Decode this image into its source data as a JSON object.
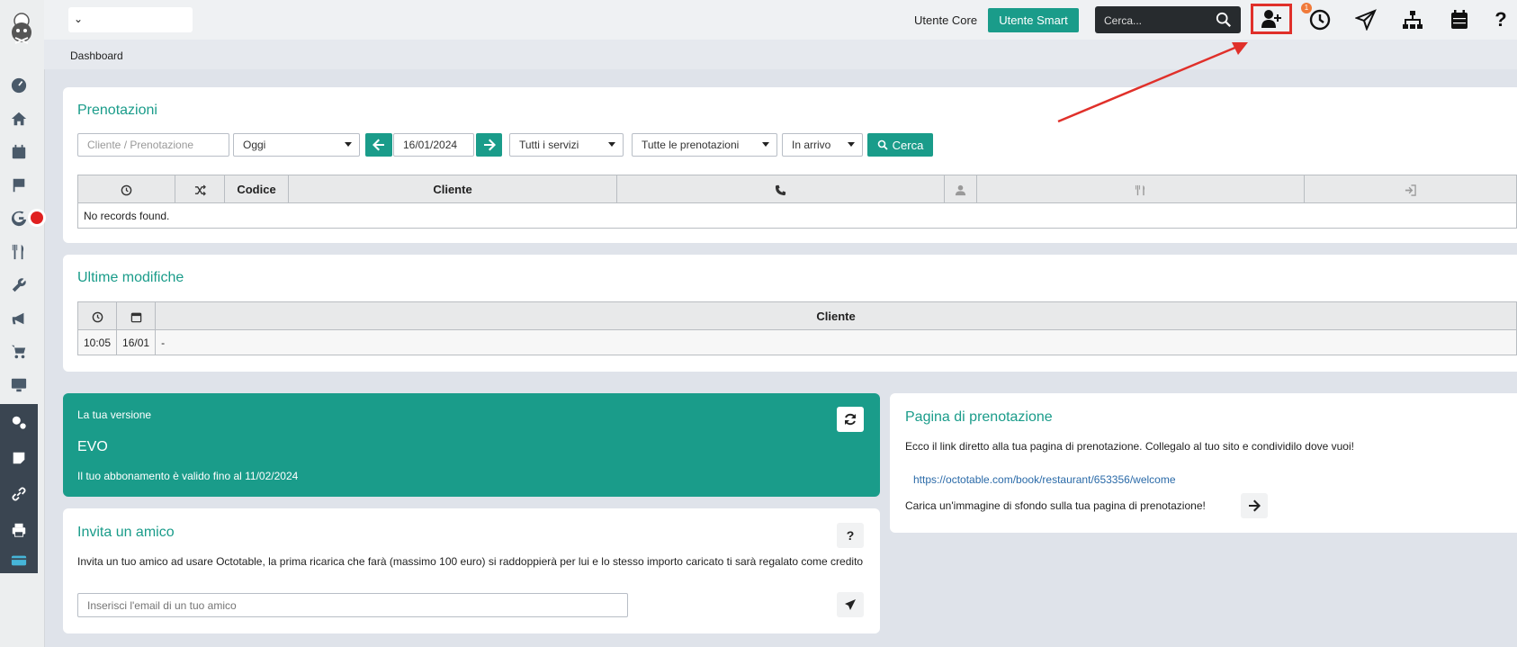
{
  "topbar": {
    "utente_core": "Utente Core",
    "utente_smart": "Utente Smart",
    "search_placeholder": "Cerca...",
    "notification_count": "1",
    "help": "?"
  },
  "breadcrumb": "Dashboard",
  "prenotazioni": {
    "title": "Prenotazioni",
    "search_placeholder": "Cliente / Prenotazione",
    "period": "Oggi",
    "date": "16/01/2024",
    "services": "Tutti i servizi",
    "bookings": "Tutte le prenotazioni",
    "status": "In arrivo",
    "search_button": "Cerca",
    "columns": [
      "",
      "",
      "Codice",
      "Cliente",
      "",
      "",
      "",
      ""
    ],
    "empty": "No records found."
  },
  "ultime": {
    "title": "Ultime modifiche",
    "column_cliente": "Cliente",
    "row": {
      "time": "10:05",
      "date": "16/01",
      "cliente": "-"
    }
  },
  "versione": {
    "label": "La tua versione",
    "name": "EVO",
    "validity": "Il tuo abbonamento è valido fino al 11/02/2024"
  },
  "invita": {
    "title": "Invita un amico",
    "help": "?",
    "text": "Invita un tuo amico ad usare Octotable, la prima ricarica che farà (massimo 100 euro) si raddoppierà per lui e lo stesso importo caricato ti sarà regalato come credito",
    "email_placeholder": "Inserisci l'email di un tuo amico"
  },
  "pagina": {
    "title": "Pagina di prenotazione",
    "text": "Ecco il link diretto alla tua pagina di prenotazione. Collegalo al tuo sito e condividilo dove vuoi!",
    "url": "https://octotable.com/book/restaurant/653356/welcome",
    "background_text": "Carica un'immagine di sfondo sulla tua pagina di prenotazione!"
  },
  "colors": {
    "accent": "#1a9c8a",
    "highlight": "#e0302a",
    "dark": "#272b2e"
  }
}
